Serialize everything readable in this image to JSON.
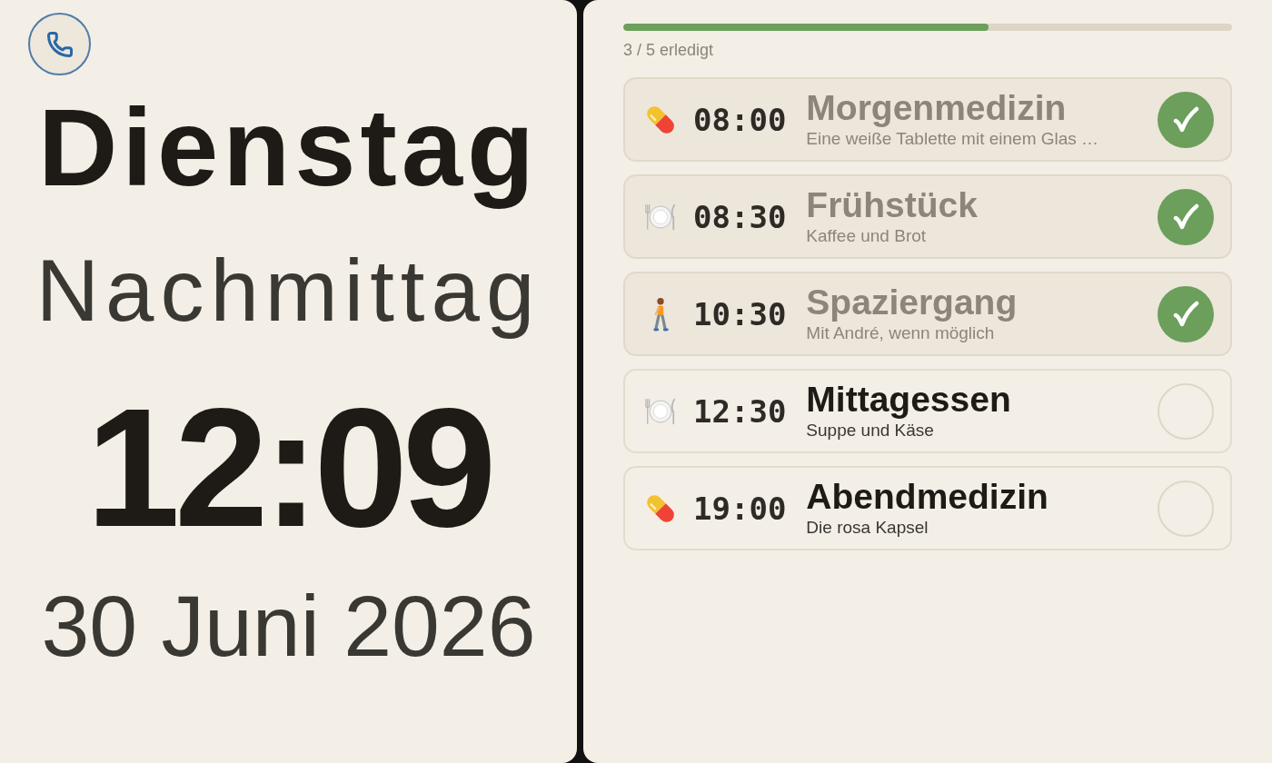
{
  "clock": {
    "weekday": "Dienstag",
    "daypart": "Nachmittag",
    "time": "12:09",
    "date": "30 Juni 2026"
  },
  "progress": {
    "level": 0.6,
    "label": "3 / 5 erledigt"
  },
  "tasks": [
    {
      "kind": "pill",
      "time": "08:00",
      "title": "Morgenmedizin",
      "note": "Eine weiße Tablette mit einem Glas …",
      "done": true
    },
    {
      "kind": "meal",
      "time": "08:30",
      "title": "Frühstück",
      "note": "Kaffee und Brot",
      "done": true
    },
    {
      "kind": "walk",
      "time": "10:30",
      "title": "Spaziergang",
      "note": "Mit André, wenn möglich",
      "done": true
    },
    {
      "kind": "meal",
      "time": "12:30",
      "title": "Mittagessen",
      "note": "Suppe und Käse",
      "done": false
    },
    {
      "kind": "pill",
      "time": "19:00",
      "title": "Abendmedizin",
      "note": "Die rosa Kapsel",
      "done": false
    }
  ]
}
